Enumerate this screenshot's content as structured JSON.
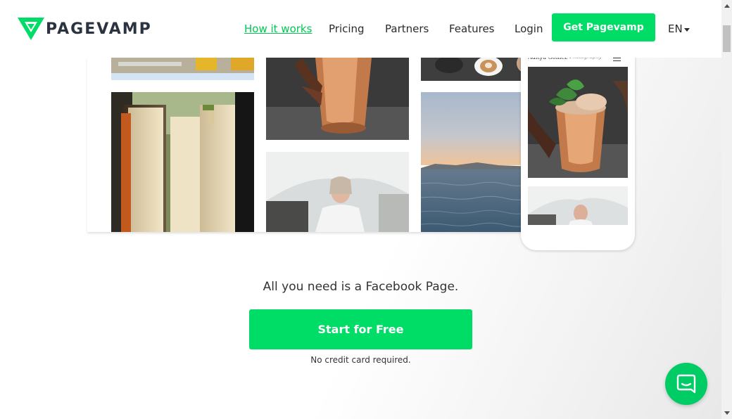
{
  "brand": {
    "name": "PAGEVAMP",
    "accent": "#00dd66",
    "logo_icon": "pagevamp-v-logo-icon"
  },
  "nav": {
    "how_it_works": "How it works",
    "pricing": "Pricing",
    "partners": "Partners",
    "features": "Features",
    "login": "Login",
    "cta": "Get Pagevamp",
    "language": "EN"
  },
  "showcase": {
    "phone_name": "Aditya Gomez",
    "phone_subtitle": "Photography"
  },
  "hero": {
    "tagline": "All you need is a Facebook Page.",
    "cta": "Start for Free",
    "note": "No credit card required."
  },
  "chat": {
    "icon": "chat-bubble-icon"
  }
}
